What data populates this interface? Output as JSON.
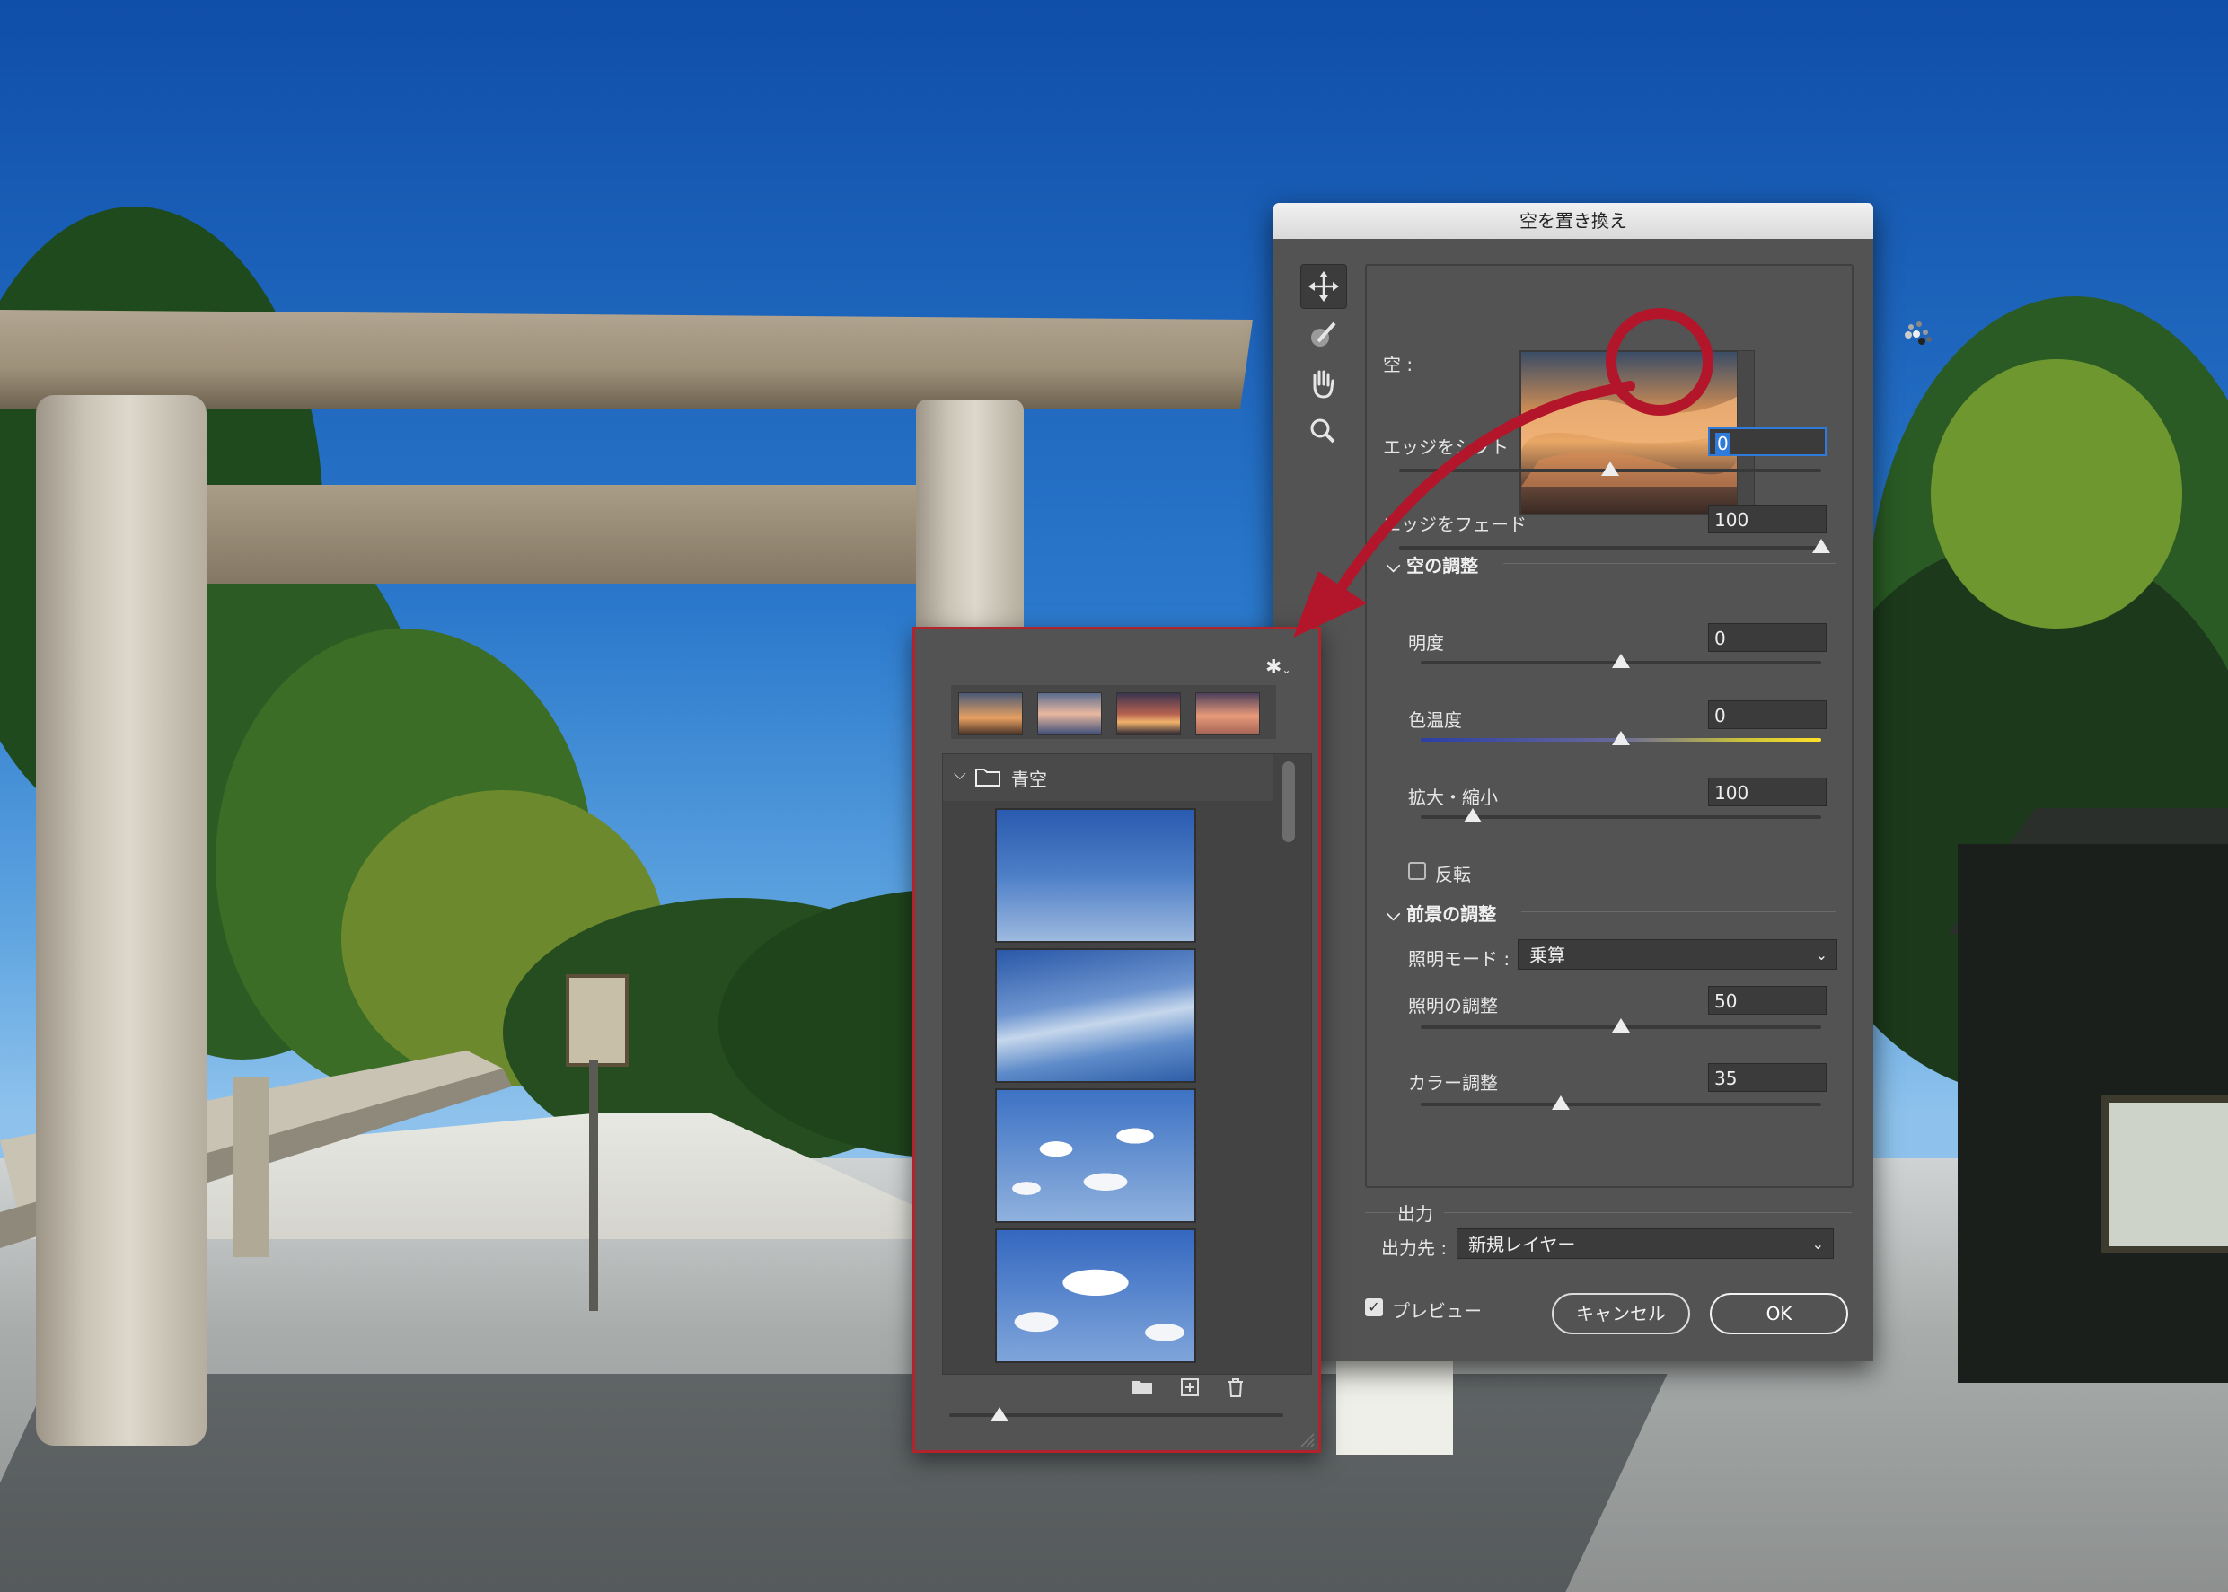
{
  "dialog": {
    "title": "空を置き換え",
    "sky_label": "空 :",
    "edge_shift": {
      "label": "エッジをシフト",
      "value": "0",
      "level": 0.5
    },
    "edge_fade": {
      "label": "エッジをフェード",
      "value": "100",
      "level": 1.0
    },
    "sky_adjust": {
      "heading": "空の調整",
      "brightness": {
        "label": "明度",
        "value": "0",
        "level": 0.5
      },
      "temperature": {
        "label": "色温度",
        "value": "0",
        "level": 0.5
      },
      "scale": {
        "label": "拡大・縮小",
        "value": "100",
        "level": 0.13
      },
      "flip_label": "反転",
      "flip_checked": false
    },
    "fg_adjust": {
      "heading": "前景の調整",
      "lighting_mode_label": "照明モード :",
      "lighting_mode_value": "乗算",
      "lighting": {
        "label": "照明の調整",
        "value": "50",
        "level": 0.5
      },
      "color": {
        "label": "カラー調整",
        "value": "35",
        "level": 0.35
      }
    },
    "output": {
      "heading": "出力",
      "dest_label": "出力先 :",
      "dest_value": "新規レイヤー"
    },
    "preview_label": "プレビュー",
    "preview_checked": true,
    "cancel_label": "キャンセル",
    "ok_label": "OK",
    "tools": [
      "move-icon",
      "sky-brush-icon",
      "hand-icon",
      "zoom-icon"
    ]
  },
  "popup": {
    "folder_name": "青空",
    "gear_icon": "gear-icon",
    "footer_icons": [
      "folder-icon",
      "new-item-icon",
      "trash-icon"
    ],
    "size_level": 0.15
  },
  "colors": {
    "annotation": "#b3162a",
    "focus": "#2e7bdc"
  }
}
